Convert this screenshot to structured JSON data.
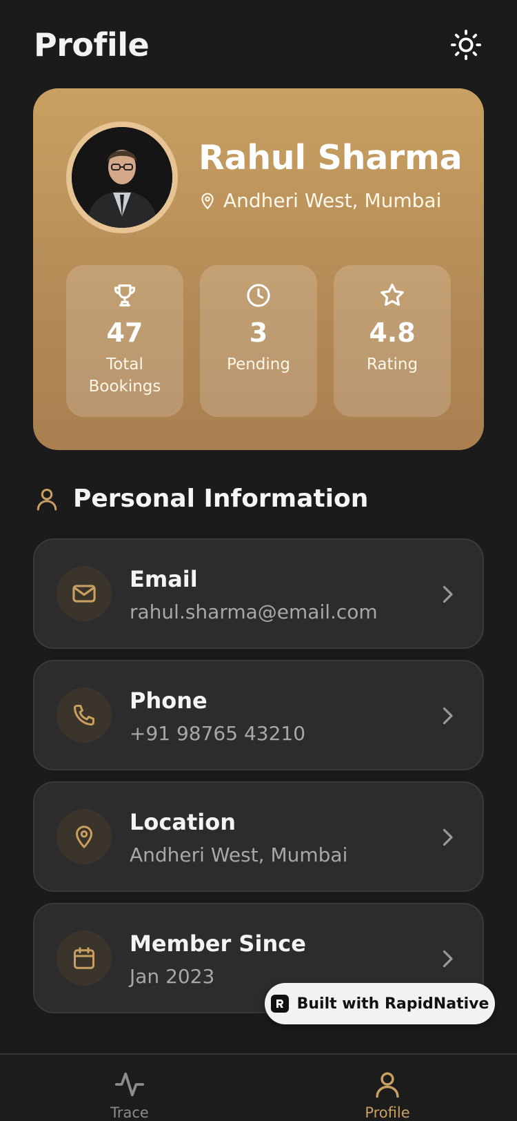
{
  "header": {
    "title": "Profile",
    "theme_icon": "sun-icon"
  },
  "profile": {
    "name": "Rahul Sharma",
    "location": "Andheri West, Mumbai",
    "avatar_alt": "profile-photo",
    "stats": [
      {
        "icon": "trophy-icon",
        "value": "47",
        "label": "Total Bookings"
      },
      {
        "icon": "clock-icon",
        "value": "3",
        "label": "Pending"
      },
      {
        "icon": "star-icon",
        "value": "4.8",
        "label": "Rating"
      }
    ]
  },
  "personal_info": {
    "title": "Personal Information",
    "icon": "user-icon",
    "items": [
      {
        "icon": "mail-icon",
        "label": "Email",
        "value": "rahul.sharma@email.com"
      },
      {
        "icon": "phone-icon",
        "label": "Phone",
        "value": "+91 98765 43210"
      },
      {
        "icon": "map-pin-icon",
        "label": "Location",
        "value": "Andheri West, Mumbai"
      },
      {
        "icon": "calendar-icon",
        "label": "Member Since",
        "value": "Jan 2023"
      }
    ]
  },
  "badge": {
    "text": "Built with RapidNative"
  },
  "tabs": [
    {
      "label": "Trace",
      "icon": "activity-icon",
      "active": false
    },
    {
      "label": "Profile",
      "icon": "user-icon",
      "active": true
    }
  ],
  "colors": {
    "background": "#1b1b1b",
    "accent": "#c9a061",
    "card": "#2c2c2c",
    "card_gradient_top": "#c9a061",
    "card_gradient_bottom": "#a97f50"
  }
}
